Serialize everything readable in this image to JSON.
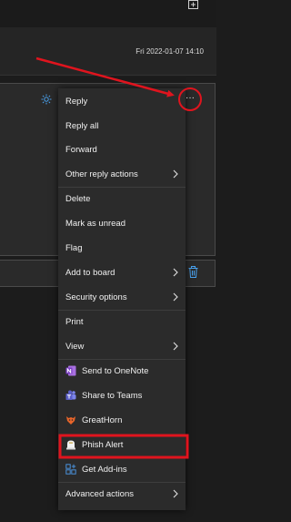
{
  "message": {
    "date": "Fri 2022-01-07 14:10"
  },
  "more_button_label": "···",
  "menu": {
    "items": [
      {
        "label": "Reply"
      },
      {
        "label": "Reply all"
      },
      {
        "label": "Forward"
      },
      {
        "label": "Other reply actions"
      },
      {
        "label": "Delete"
      },
      {
        "label": "Mark as unread"
      },
      {
        "label": "Flag"
      },
      {
        "label": "Add to board"
      },
      {
        "label": "Security options"
      },
      {
        "label": "Print"
      },
      {
        "label": "View"
      },
      {
        "label": "Send to OneNote"
      },
      {
        "label": "Share to Teams"
      },
      {
        "label": "GreatHorn"
      },
      {
        "label": "Phish Alert"
      },
      {
        "label": "Get Add-ins"
      },
      {
        "label": "Advanced actions"
      }
    ]
  },
  "colors": {
    "annotation_red": "#e0141e",
    "onenote_purple": "#7b3fc4",
    "teams_purple": "#5b5fc7",
    "greathorn_orange": "#e8652a",
    "addins_blue": "#4a90d9",
    "accent_blue": "#4aa3f0"
  }
}
